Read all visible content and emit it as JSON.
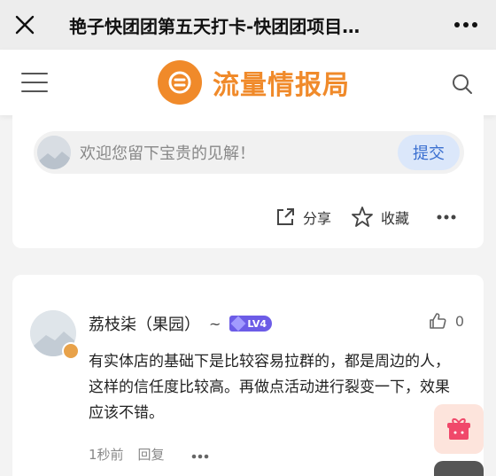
{
  "window": {
    "title": "艳子快团团第五天打卡-快团团项目…"
  },
  "header": {
    "logo_text": "流量情报局",
    "brand_color": "#f08a2a"
  },
  "comment_input": {
    "placeholder": "欢迎您留下宝贵的见解！",
    "submit_label": "提交"
  },
  "actions": {
    "share_label": "分享",
    "favorite_label": "收藏"
  },
  "comment": {
    "username": "荔枝柒（果园）",
    "suffix": "~",
    "level": "LV4",
    "likes": "0",
    "text": "有实体店的基础下是比较容易拉群的，都是周边的人，这样的信任度比较高。再做点活动进行裂变一下，效果应该不错。",
    "time": "1秒前",
    "reply_label": "回复"
  },
  "icons": {
    "close": "close-icon",
    "more": "more-icon",
    "menu": "menu-icon",
    "search": "search-icon",
    "share": "share-icon",
    "star": "star-icon",
    "like": "thumbs-up-icon",
    "gift": "gift-icon"
  }
}
